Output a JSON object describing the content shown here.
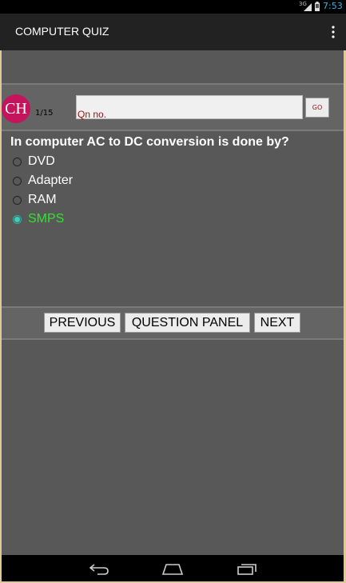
{
  "status_bar": {
    "network": "3G",
    "time": "7:53"
  },
  "app_bar": {
    "title": "COMPUTER QUIZ",
    "menu_icon": "overflow-menu-icon"
  },
  "quiz_header": {
    "avatar_text": "CH",
    "counter": "1/15",
    "question_number_placeholder": "Qn no.",
    "go_label": "GO"
  },
  "question": {
    "text": "In computer AC to DC conversion is done by?",
    "options": [
      {
        "label": "DVD",
        "selected": false
      },
      {
        "label": "Adapter",
        "selected": false
      },
      {
        "label": "RAM",
        "selected": false
      },
      {
        "label": "SMPS",
        "selected": true
      }
    ]
  },
  "navigation": {
    "previous_label": "PREVIOUS",
    "panel_label": "QUESTION PANEL",
    "next_label": "NEXT"
  },
  "system_nav": {
    "back_icon": "back-icon",
    "home_icon": "home-icon",
    "recents_icon": "recents-icon"
  },
  "colors": {
    "accent": "#33b5e5",
    "selected_option": "#2ee62a",
    "avatar": "#c4145c"
  }
}
